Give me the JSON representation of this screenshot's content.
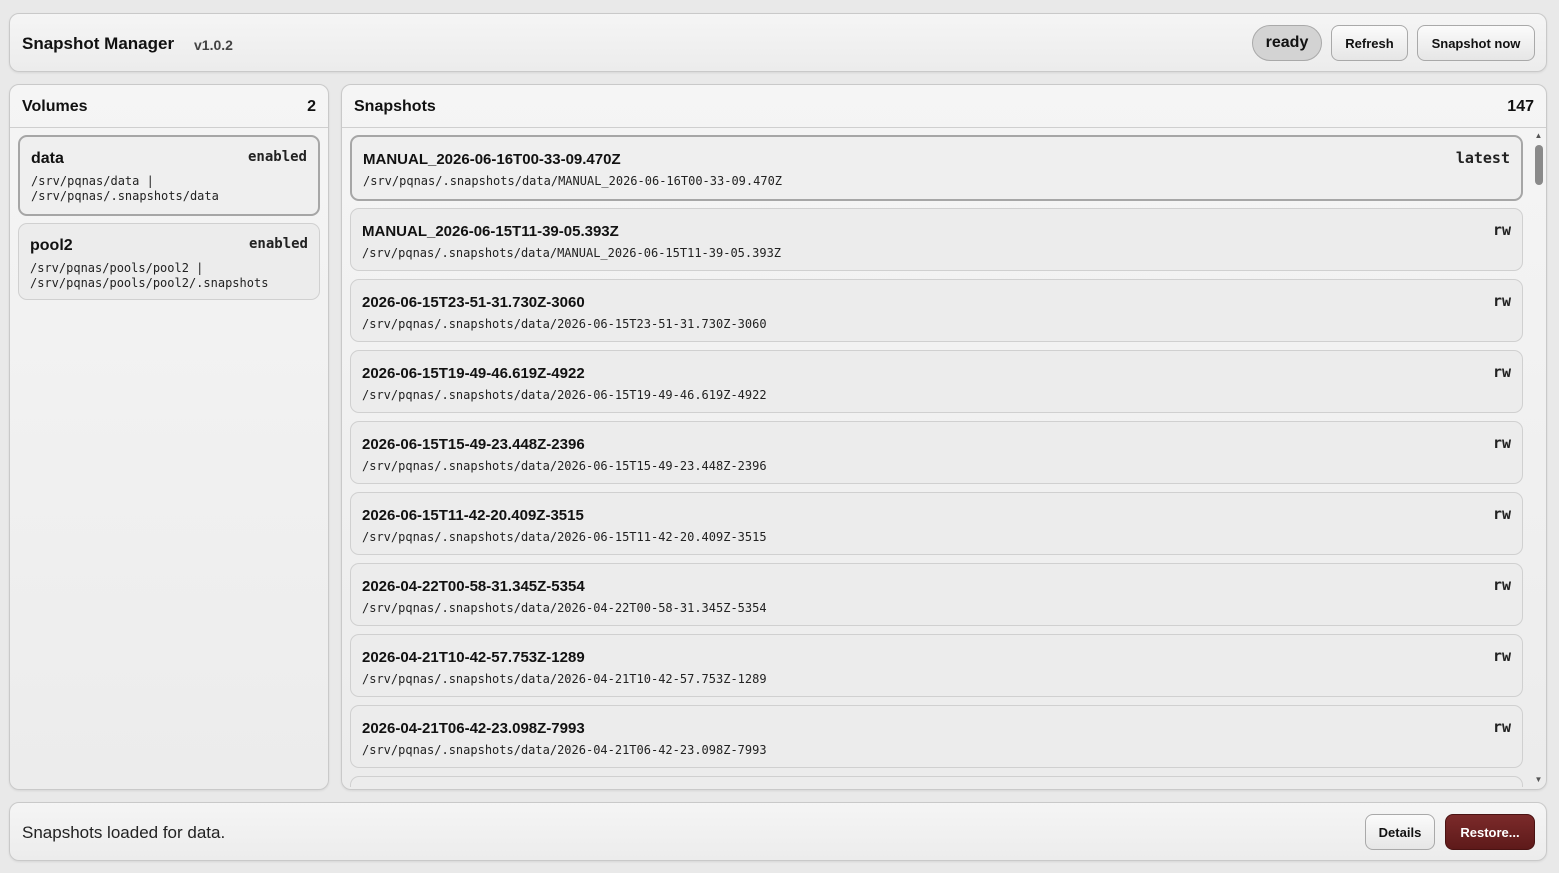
{
  "header": {
    "title": "Snapshot Manager",
    "version": "v1.0.2",
    "status": "ready",
    "refresh_label": "Refresh",
    "snapshot_now_label": "Snapshot now"
  },
  "volumes": {
    "title": "Volumes",
    "count": "2",
    "items": [
      {
        "name": "data",
        "state": "enabled",
        "path": "/srv/pqnas/data |\n/srv/pqnas/.snapshots/data"
      },
      {
        "name": "pool2",
        "state": "enabled",
        "path": "/srv/pqnas/pools/pool2 |\n/srv/pqnas/pools/pool2/.snapshots"
      }
    ]
  },
  "snapshots": {
    "title": "Snapshots",
    "count": "147",
    "items": [
      {
        "name": "MANUAL_2026-06-16T00-33-09.470Z",
        "tag": "latest",
        "path": "/srv/pqnas/.snapshots/data/MANUAL_2026-06-16T00-33-09.470Z"
      },
      {
        "name": "MANUAL_2026-06-15T11-39-05.393Z",
        "tag": "rw",
        "path": "/srv/pqnas/.snapshots/data/MANUAL_2026-06-15T11-39-05.393Z"
      },
      {
        "name": "2026-06-15T23-51-31.730Z-3060",
        "tag": "rw",
        "path": "/srv/pqnas/.snapshots/data/2026-06-15T23-51-31.730Z-3060"
      },
      {
        "name": "2026-06-15T19-49-46.619Z-4922",
        "tag": "rw",
        "path": "/srv/pqnas/.snapshots/data/2026-06-15T19-49-46.619Z-4922"
      },
      {
        "name": "2026-06-15T15-49-23.448Z-2396",
        "tag": "rw",
        "path": "/srv/pqnas/.snapshots/data/2026-06-15T15-49-23.448Z-2396"
      },
      {
        "name": "2026-06-15T11-42-20.409Z-3515",
        "tag": "rw",
        "path": "/srv/pqnas/.snapshots/data/2026-06-15T11-42-20.409Z-3515"
      },
      {
        "name": "2026-04-22T00-58-31.345Z-5354",
        "tag": "rw",
        "path": "/srv/pqnas/.snapshots/data/2026-04-22T00-58-31.345Z-5354"
      },
      {
        "name": "2026-04-21T10-42-57.753Z-1289",
        "tag": "rw",
        "path": "/srv/pqnas/.snapshots/data/2026-04-21T10-42-57.753Z-1289"
      },
      {
        "name": "2026-04-21T06-42-23.098Z-7993",
        "tag": "rw",
        "path": "/srv/pqnas/.snapshots/data/2026-04-21T06-42-23.098Z-7993"
      }
    ]
  },
  "footer": {
    "status_message": "Snapshots loaded for data.",
    "details_label": "Details",
    "restore_label": "Restore..."
  },
  "colors": {
    "background": "#e9e9e9",
    "restore_button": "#6b2222"
  }
}
